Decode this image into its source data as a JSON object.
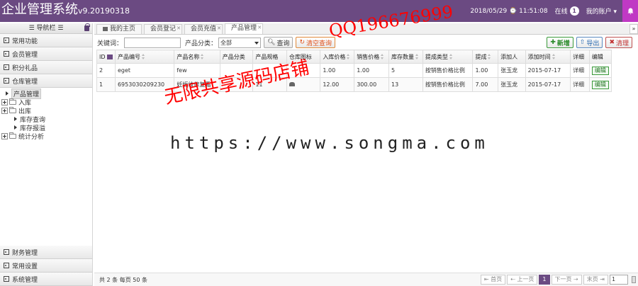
{
  "header": {
    "title": "企业管理系统",
    "version": "v9.20190318",
    "datetime": "2018/05/29 ⌚ 11:51:08",
    "online_label": "在线",
    "online_count": "1",
    "account_label": "我的账户 ▾"
  },
  "sidebar": {
    "nav_title": "☰ 导航栏 ☰",
    "top_sections": [
      {
        "label": "常用功能"
      },
      {
        "label": "会员管理"
      },
      {
        "label": "积分礼品"
      },
      {
        "label": "仓库管理"
      }
    ],
    "tree": {
      "product": "产品管理",
      "inbound": "入库",
      "outbound": "出库",
      "stock_query": "库存查询",
      "stock_loss": "库存报溢",
      "stats": "统计分析"
    },
    "bottom_sections": [
      {
        "label": "财务管理"
      },
      {
        "label": "常用设置"
      },
      {
        "label": "系统管理"
      }
    ]
  },
  "tabs": [
    {
      "label": "我的主页"
    },
    {
      "label": "会员登记"
    },
    {
      "label": "会员充值"
    },
    {
      "label": "产品管理"
    }
  ],
  "toolbar": {
    "keyword_label": "关键词：",
    "category_label": "产品分类：",
    "category_value": "全部",
    "search_label": "查询",
    "clear_label": "清空查询",
    "add_label": "新增",
    "export_label": "导出",
    "purge_label": "清理"
  },
  "table": {
    "headers": [
      "ID",
      "产品编号",
      "产品名称",
      "产品分类",
      "产品规格",
      "仓库图标",
      "入库价格",
      "销售价格",
      "库存数量",
      "提成类型",
      "提成",
      "添加人",
      "添加时间",
      "详细",
      "编辑"
    ],
    "rows": [
      {
        "id": "2",
        "code": "eget",
        "name": "few",
        "category": "",
        "spec": "",
        "in_price": "1.00",
        "sale_price": "1.00",
        "qty": "5",
        "comm_type": "按销售价格比例",
        "comm": "1.00",
        "creator": "张玉龙",
        "date": "2015-07-17",
        "detail": "详细",
        "edit": "编辑"
      },
      {
        "id": "1",
        "code": "6953030209230",
        "name": "妊娠纹修复霜",
        "category": "",
        "spec": "11",
        "in_price": "12.00",
        "sale_price": "300.00",
        "qty": "13",
        "comm_type": "按销售价格比例",
        "comm": "7.00",
        "creator": "张玉龙",
        "date": "2015-07-17",
        "detail": "详细",
        "edit": "编辑"
      }
    ]
  },
  "pager": {
    "summary": "共 2 条 每页 50 条",
    "first": "首页",
    "prev": "上一页",
    "current": "1",
    "next": "下一页",
    "last": "末页",
    "page_input": "1"
  },
  "watermarks": {
    "red1": "无限共享源码店铺",
    "red2": "QQ196676999",
    "url": "https://www.songma.com"
  },
  "colors": {
    "header_bg": "#6b4a82",
    "bell_bg": "#c039c4",
    "watermark": "#ff0000"
  }
}
